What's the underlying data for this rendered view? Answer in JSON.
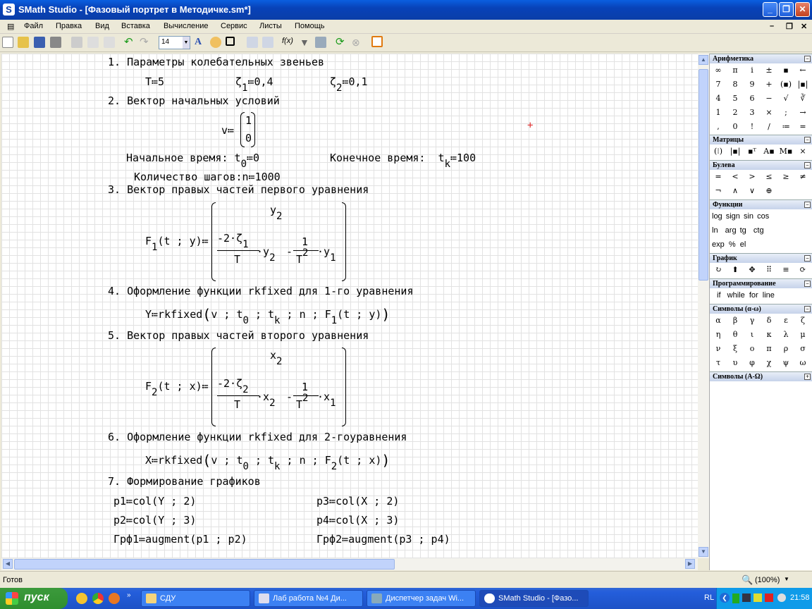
{
  "window": {
    "title": "SMath Studio - [Фазовый портрет в Методичке.sm*]",
    "app_icon": "S"
  },
  "menu": [
    "Файл",
    "Правка",
    "Вид",
    "Вставка",
    "Вычисление",
    "Сервис",
    "Листы",
    "Помощь"
  ],
  "toolbar": {
    "font_size": "14"
  },
  "doc": {
    "s1": "1. Параметры колебательных звеньев",
    "s1_T": "T≔5",
    "s1_z1a": "ζ",
    "s1_z1s": "1",
    "s1_z1b": "≔0,4",
    "s1_z2a": "ζ",
    "s1_z2s": "2",
    "s1_z2b": "≔0,1",
    "s2": "2. Вектор начальных условий",
    "s2_v": "v≔",
    "s2_v1": "1",
    "s2_v2": "0",
    "s2_t0a": "Начальное время: t",
    "s2_t0s": "0",
    "s2_t0b": "≔0",
    "s2_tka": "Конечное время:  t",
    "s2_tks": "k",
    "s2_tkb": "≔100",
    "s2_n": "Количество шагов:n≔1000",
    "s3": "3. Вектор правых частей первого уравнения",
    "s3_F": "F",
    "s3_Fs": "1",
    "s3_Fargs": "(t ; y)≔",
    "s3_top": "y",
    "s3_tops": "2",
    "s3_num1": "-2·ζ",
    "s3_num1s": "1",
    "s3_den1": "T",
    "s3_y2": "·y",
    "s3_y2s": "2",
    "s3_minus": "-",
    "s3_num2": "1",
    "s3_den2": "T",
    "s3_den2s": "2",
    "s3_y1": "·y",
    "s3_y1s": "1",
    "s4": "4. Оформление функции rkfixed для 1-го уравнения",
    "s4_a": "Y≔rkfixed",
    "s4_b": "v ; t",
    "s4_c": "0",
    "s4_d": " ; t",
    "s4_e": "k",
    "s4_f": " ; n ; F",
    "s4_g": "1",
    "s4_h": "(t ; y)",
    "s5": "5. Вектор правых частей второго уравнения",
    "s5_F": "F",
    "s5_Fs": "2",
    "s5_Fargs": "(t ; x)≔",
    "s5_top": "x",
    "s5_tops": "2",
    "s5_num1": "-2·ζ",
    "s5_num1s": "2",
    "s5_den1": "T",
    "s5_x2": "·x",
    "s5_x2s": "2",
    "s5_minus": "-",
    "s5_num2": "1",
    "s5_den2": "T",
    "s5_den2s": "2",
    "s5_x1": "·x",
    "s5_x1s": "1",
    "s6": "6. Оформление функции rkfixed для 2-гоуравнения",
    "s6_a": "X≔rkfixed",
    "s6_b": "v ; t",
    "s6_c": "0",
    "s6_d": " ; t",
    "s6_e": "k",
    "s6_f": " ; n ; F",
    "s6_g": "2",
    "s6_h": "(t ; x)",
    "s7": "7. Формирование графиков",
    "p1": "p1≔col(Y ; 2)",
    "p2": "p2≔col(Y ; 3)",
    "grf1": "Грф1≔augment(p1 ; p2)",
    "p3": "p3≔col(X ; 2)",
    "p4": "p4≔col(X ; 3)",
    "grf2": "Грф2≔augment(p3 ; p4)"
  },
  "panel": {
    "arith_title": "Арифметика",
    "arith": [
      "∞",
      "π",
      "i",
      "±",
      "▪",
      "←",
      "7",
      "8",
      "9",
      "+",
      "(▪)",
      "|▪|",
      "4",
      "5",
      "6",
      "−",
      "√",
      "∛",
      "1",
      "2",
      "3",
      "×",
      ";",
      "→",
      ",",
      "0",
      "!",
      "/",
      "≔",
      "="
    ],
    "matrix_title": "Матрицы",
    "bool_title": "Булева",
    "bool": [
      "=",
      "<",
      ">",
      "≤",
      "≥",
      "≠",
      "¬",
      "∧",
      "∨",
      "⊕"
    ],
    "func_title": "Функции",
    "func_row1": "log sign sin cos",
    "func_row2": "ln  arg tg  ctg",
    "func_row3": "exp  %  el",
    "graph_title": "График",
    "prog_title": "Программирование",
    "prog": "if   while  for  line",
    "greek_title": "Символы (α-ω)",
    "greek": [
      "α",
      "β",
      "γ",
      "δ",
      "ε",
      "ζ",
      "η",
      "θ",
      "ι",
      "κ",
      "λ",
      "μ",
      "ν",
      "ξ",
      "ο",
      "π",
      "ρ",
      "σ",
      "τ",
      "υ",
      "φ",
      "χ",
      "ψ",
      "ω"
    ],
    "greek_upper_title": "Символы (Α-Ω)"
  },
  "status": {
    "text": "Готов",
    "zoom": "(100%)"
  },
  "taskbar": {
    "start": "пуск",
    "tasks": [
      "СДУ",
      "Лаб работа №4 Ди...",
      "Диспетчер задач Wi...",
      "SMath Studio - [Фазо..."
    ],
    "lang": "RL",
    "clock": "21:58"
  }
}
